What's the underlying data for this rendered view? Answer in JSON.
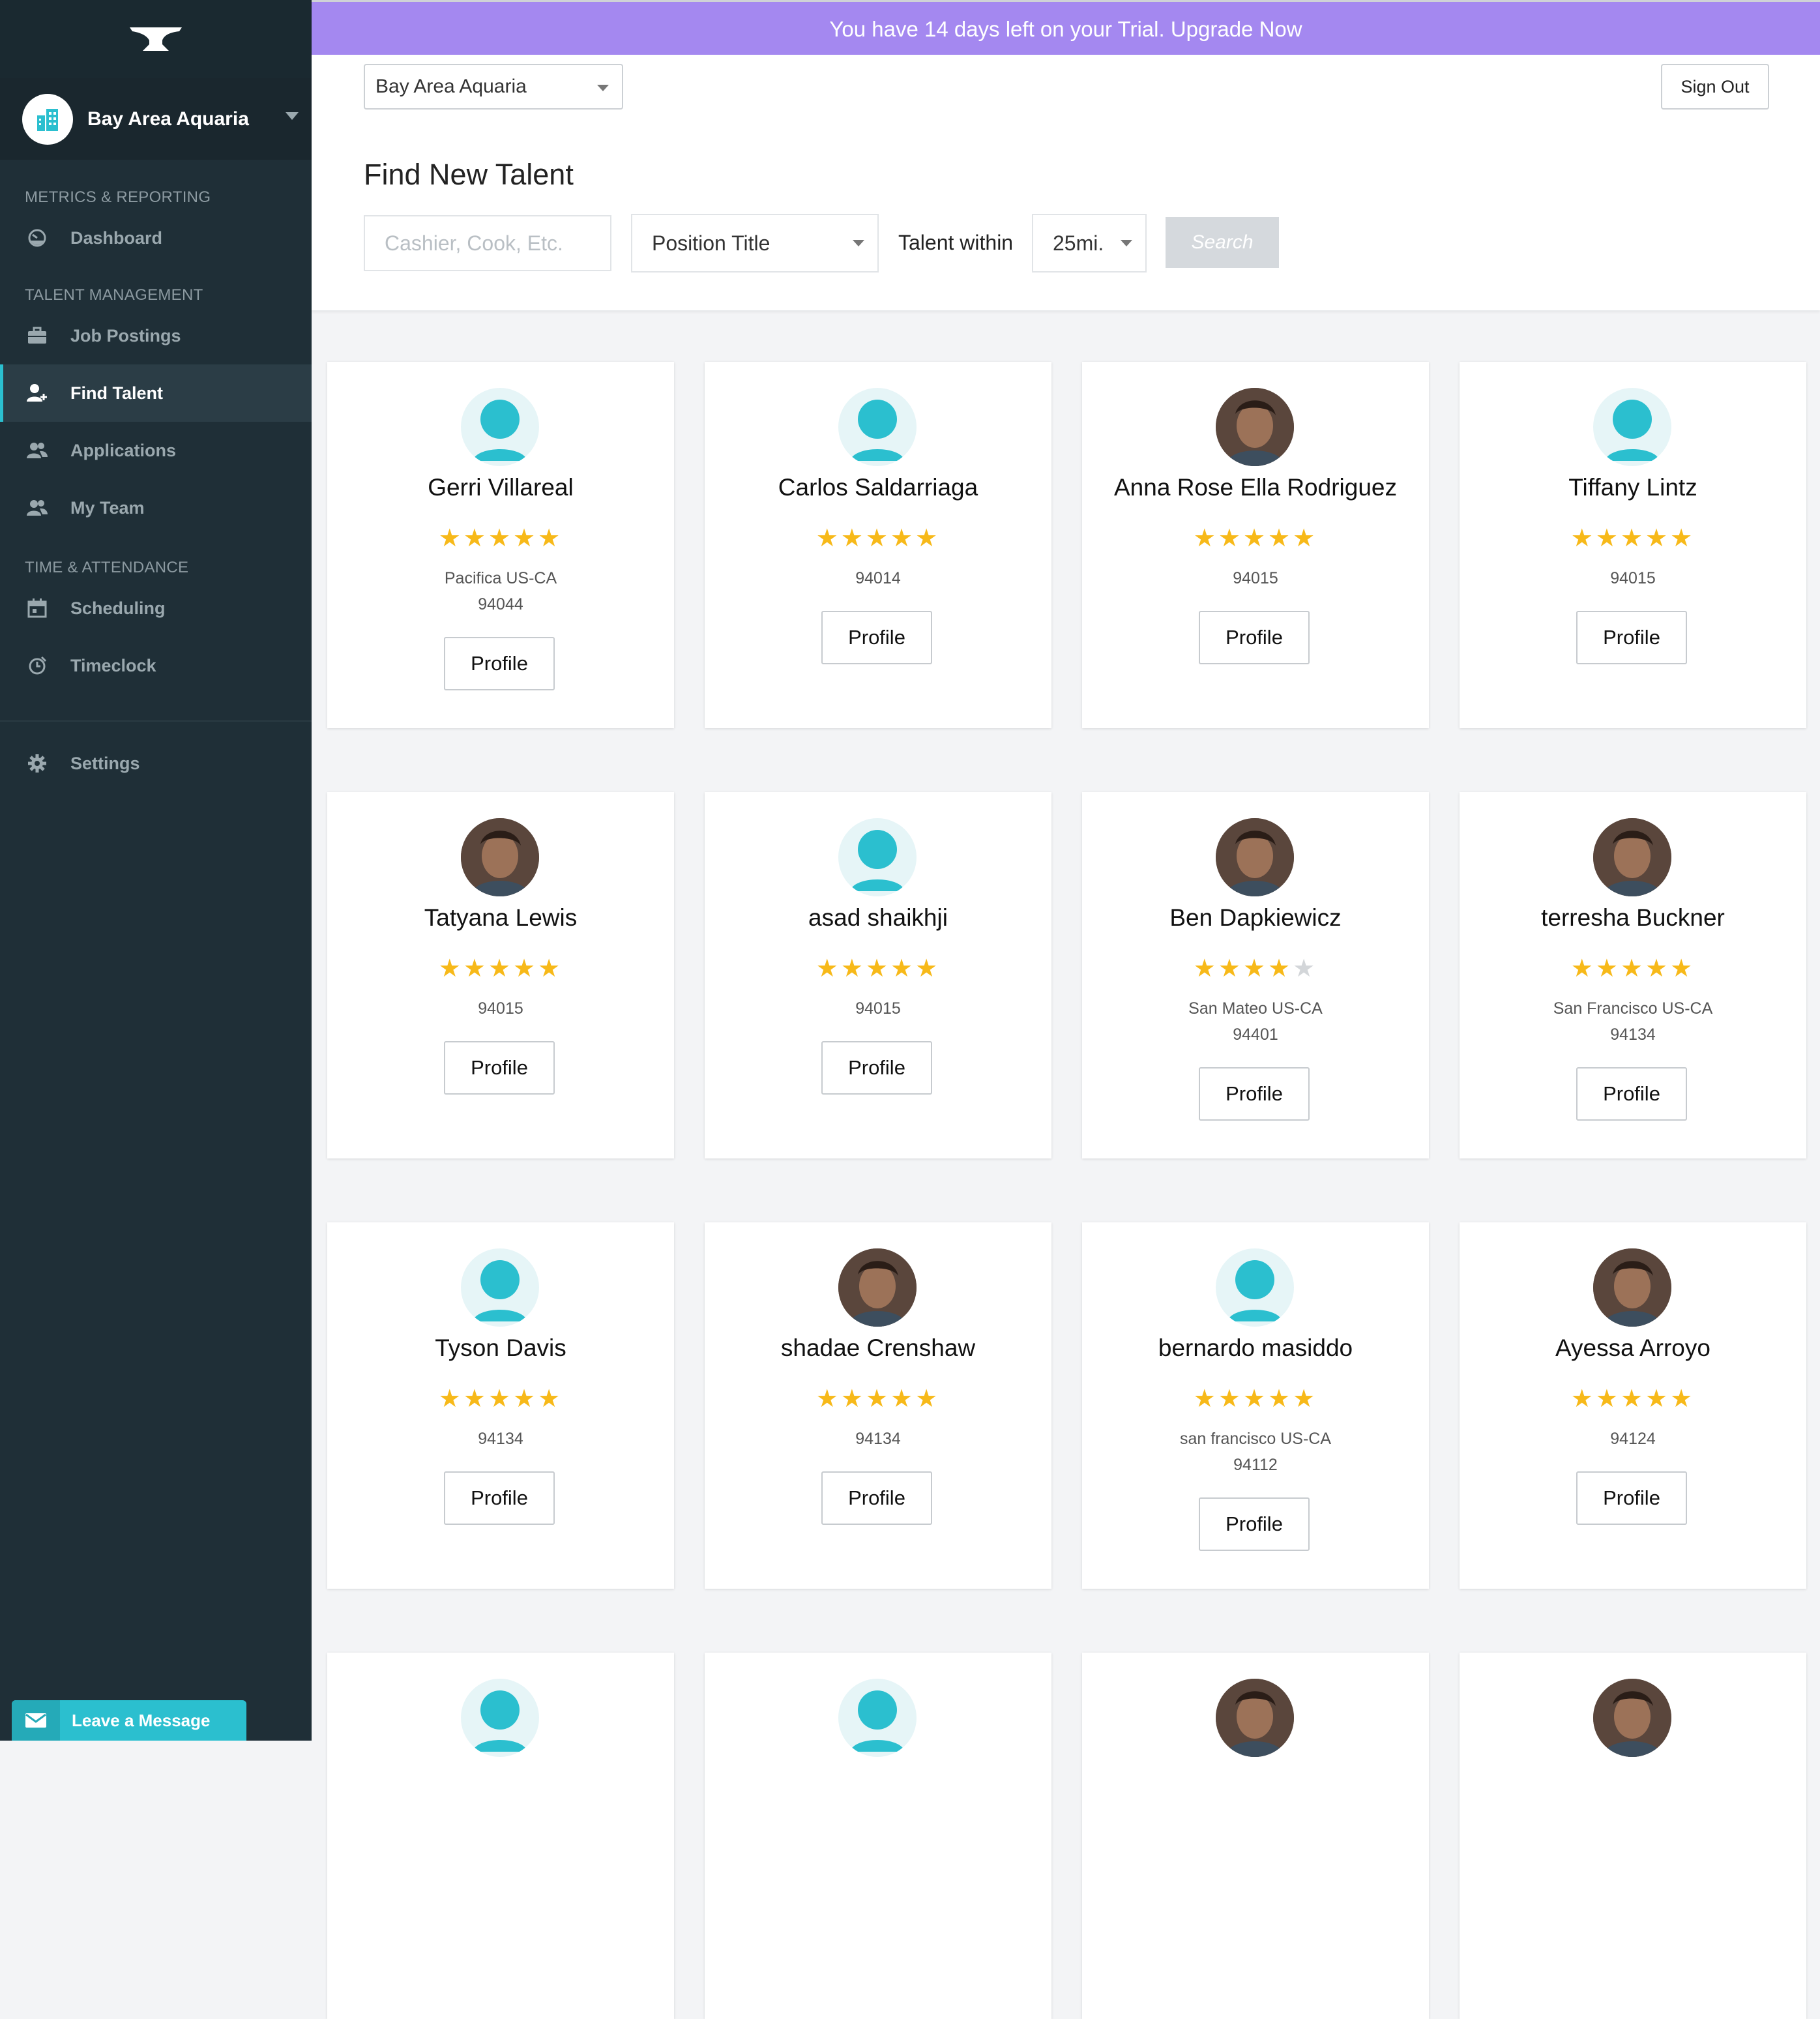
{
  "trial_banner": "You have 14 days left on your Trial. Upgrade Now",
  "sidebar": {
    "org_name": "Bay Area Aquaria",
    "sections": [
      {
        "title": "METRICS & REPORTING"
      },
      {
        "title": "TALENT MANAGEMENT"
      },
      {
        "title": "TIME & ATTENDANCE"
      }
    ],
    "items": {
      "dashboard": "Dashboard",
      "job_postings": "Job Postings",
      "find_talent": "Find Talent",
      "applications": "Applications",
      "my_team": "My Team",
      "scheduling": "Scheduling",
      "timeclock": "Timeclock",
      "settings": "Settings"
    },
    "leave_message": "Leave a Message"
  },
  "topbar": {
    "org_select": "Bay Area Aquaria",
    "sign_out": "Sign Out"
  },
  "search": {
    "title": "Find New Talent",
    "keyword_placeholder": "Cashier, Cook, Etc.",
    "position_select": "Position Title",
    "talent_within_label": "Talent within",
    "distance_select": "25mi.",
    "search_button": "Search"
  },
  "profile_label": "Profile",
  "colors": {
    "accent": "#2bbfcf",
    "trial_banner": "#a488f0",
    "sidebar": "#1f2f37",
    "star": "#f7b919"
  },
  "candidates": [
    {
      "name": "Gerri Villareal",
      "rating": 5,
      "city": "Pacifica US-CA",
      "zip": "94044",
      "photo": false
    },
    {
      "name": "Carlos Saldarriaga",
      "rating": 5,
      "city": "",
      "zip": "94014",
      "photo": false
    },
    {
      "name": "Anna Rose Ella Rodriguez",
      "rating": 5,
      "city": "",
      "zip": "94015",
      "photo": true
    },
    {
      "name": "Tiffany Lintz",
      "rating": 5,
      "city": "",
      "zip": "94015",
      "photo": false
    },
    {
      "name": "Tatyana Lewis",
      "rating": 5,
      "city": "",
      "zip": "94015",
      "photo": true
    },
    {
      "name": "asad shaikhji",
      "rating": 5,
      "city": "",
      "zip": "94015",
      "photo": false
    },
    {
      "name": "Ben Dapkiewicz",
      "rating": 4,
      "city": "San Mateo US-CA",
      "zip": "94401",
      "photo": true
    },
    {
      "name": "terresha Buckner",
      "rating": 5,
      "city": "San Francisco US-CA",
      "zip": "94134",
      "photo": true
    },
    {
      "name": "Tyson Davis",
      "rating": 5,
      "city": "",
      "zip": "94134",
      "photo": false
    },
    {
      "name": "shadae Crenshaw",
      "rating": 5,
      "city": "",
      "zip": "94134",
      "photo": true
    },
    {
      "name": "bernardo masiddo",
      "rating": 5,
      "city": "san francisco US-CA",
      "zip": "94112",
      "photo": false
    },
    {
      "name": "Ayessa Arroyo",
      "rating": 5,
      "city": "",
      "zip": "94124",
      "photo": true
    },
    {
      "name": "",
      "rating": 0,
      "city": "",
      "zip": "",
      "photo": false
    },
    {
      "name": "",
      "rating": 0,
      "city": "",
      "zip": "",
      "photo": false
    },
    {
      "name": "",
      "rating": 0,
      "city": "",
      "zip": "",
      "photo": true
    },
    {
      "name": "",
      "rating": 0,
      "city": "",
      "zip": "",
      "photo": true
    }
  ]
}
